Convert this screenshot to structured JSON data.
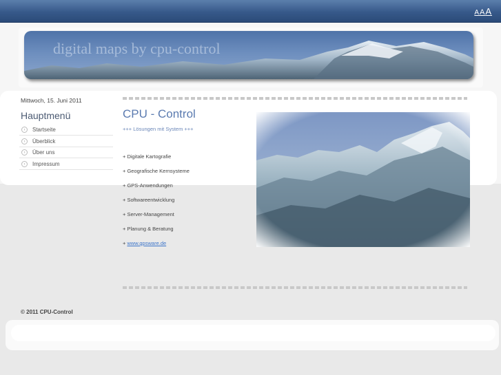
{
  "font_size_switcher": {
    "small": "A",
    "medium": "A",
    "large": "A"
  },
  "banner": {
    "title": "digital maps by cpu-control"
  },
  "date": "Mittwoch, 15. Juni 2011",
  "menu": {
    "title": "Hauptmenü",
    "items": [
      {
        "label": "Startseite"
      },
      {
        "label": "Überblick"
      },
      {
        "label": "Über uns"
      },
      {
        "label": "Impressum"
      }
    ]
  },
  "main": {
    "title": "CPU - Control",
    "slogan": "+++ Lösungen mit System +++",
    "services": [
      "+ Digitale Kartografie",
      "+ Geografische Kernsysteme",
      "+ GPS-Anwendungen",
      "+ Softwareentwicklung",
      "+ Server-Management",
      "+ Planung & Beratung"
    ],
    "link_prefix": "+ ",
    "link_text": "www.gpsware.de"
  },
  "footer": {
    "copyright": "© 2011 CPU-Control"
  },
  "colors": {
    "top_bar": "#37598a",
    "title_blue": "#5b7bb0",
    "link": "#3b74c9"
  }
}
